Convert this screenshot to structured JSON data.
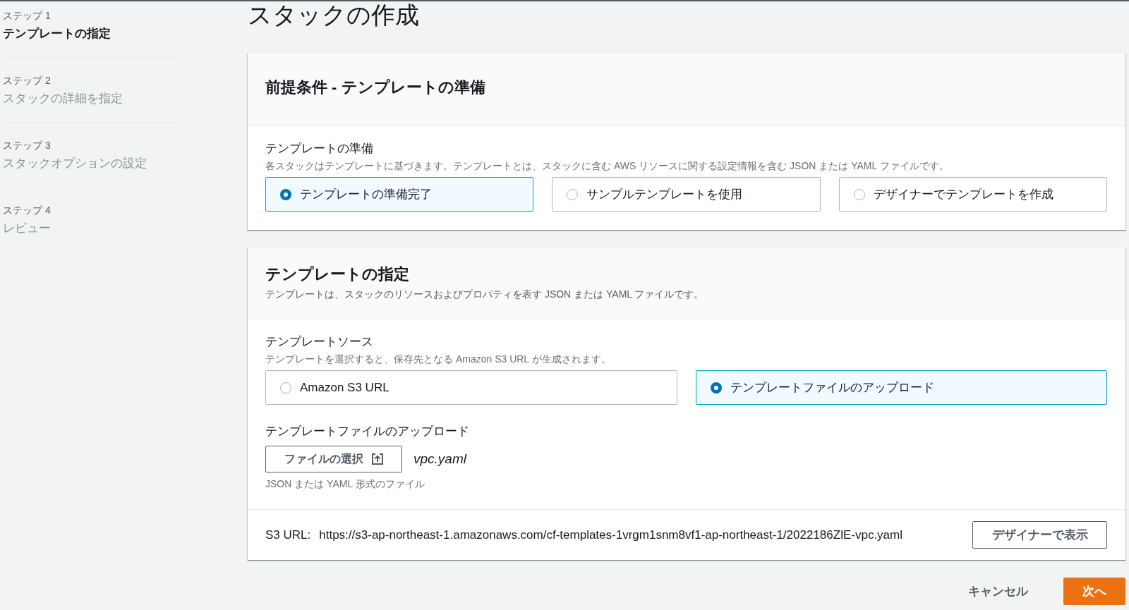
{
  "sidebar": {
    "steps": [
      {
        "label": "ステップ 1",
        "title": "テンプレートの指定",
        "selected": true
      },
      {
        "label": "ステップ 2",
        "title": "スタックの詳細を指定",
        "selected": false
      },
      {
        "label": "ステップ 3",
        "title": "スタックオプションの設定",
        "selected": false
      },
      {
        "label": "ステップ 4",
        "title": "レビュー",
        "selected": false
      }
    ]
  },
  "page_title": "スタックの作成",
  "panels": [
    {
      "title": "前提条件 - テンプレートの準備",
      "fields": [
        {
          "kind": "radio_tiles",
          "label": "テンプレートの準備",
          "description": "各スタックはテンプレートに基づきます。テンプレートとは、スタックに含む AWS リソースに関する設定情報を含む JSON または YAML ファイルです。",
          "options": [
            {
              "label": "テンプレートの準備完了",
              "selected": true
            },
            {
              "label": "サンプルテンプレートを使用",
              "selected": false
            },
            {
              "label": "デザイナーでテンプレートを作成",
              "selected": false
            }
          ]
        }
      ]
    },
    {
      "title": "テンプレートの指定",
      "description": "テンプレートは、スタックのリソースおよびプロパティを表す JSON または YAML ファイルです。",
      "fields": [
        {
          "kind": "radio_tiles",
          "label": "テンプレートソース",
          "description": "テンプレートを選択すると、保存先となる Amazon S3 URL が生成されます。",
          "options": [
            {
              "label": "Amazon S3 URL",
              "selected": false
            },
            {
              "label": "テンプレートファイルのアップロード",
              "selected": true
            }
          ]
        },
        {
          "kind": "file_upload",
          "label": "テンプレートファイルのアップロード",
          "button": "ファイルの選択",
          "file_name": "vpc.yaml",
          "hint": "JSON または YAML 形式のファイル"
        }
      ],
      "s3_url": {
        "label": "S3 URL:",
        "value": "https://s3-ap-northeast-1.amazonaws.com/cf-templates-1vrgm1snm8vf1-ap-northeast-1/2022186ZlE-vpc.yaml",
        "button": "デザイナーで表示"
      }
    }
  ],
  "footer": {
    "buttons": [
      {
        "label": "キャンセル",
        "kind": "link"
      },
      {
        "label": "次へ",
        "kind": "primary"
      }
    ]
  }
}
